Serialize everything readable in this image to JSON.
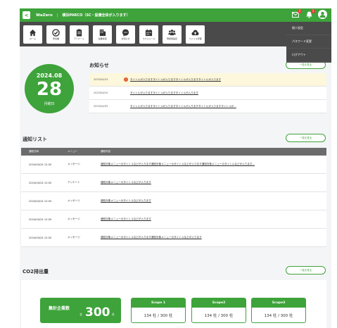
{
  "header": {
    "app_name": "WaZero",
    "separator": "|",
    "company": "横浜PARCO（SC・設備全体が入ります）",
    "mail_badge": "1",
    "bell_badge": "1"
  },
  "user_menu": {
    "items": [
      {
        "label": "個人設定"
      },
      {
        "label": "パスワード変更"
      },
      {
        "label": "ログアウト"
      }
    ]
  },
  "nav": {
    "items": [
      {
        "label": "ホーム",
        "icon": "home-icon"
      },
      {
        "label": "申出書",
        "icon": "form-icon"
      },
      {
        "label": "アンケート",
        "icon": "survey-icon"
      },
      {
        "label": "企業情報",
        "icon": "building-icon"
      },
      {
        "label": "お知らせ",
        "icon": "chat-icon"
      },
      {
        "label": "スケジュール",
        "icon": "calendar-icon"
      },
      {
        "label": "現場者設定",
        "icon": "people-icon"
      },
      {
        "label": "ファイル管理",
        "icon": "cloud-upload-icon"
      }
    ]
  },
  "date": {
    "year_month": "2024.08",
    "day": "28",
    "weekday": "月曜日"
  },
  "notices": {
    "title": "お知らせ",
    "more_label": "一覧を見る",
    "items": [
      {
        "date": "2023/04/24",
        "text": "タイトルが入りますタイトルが入りますタイトルが入りますタイトルが入ります",
        "important": true
      },
      {
        "date": "2023/04/10",
        "text": "タイトルが入りますタイトルが入りますタイトルが入ります",
        "important": false
      },
      {
        "date": "2023/04/03",
        "text": "タイトルが入りますタイトルが入りますタイトルが入りますタイトルが入りますタイトルが...",
        "important": false
      }
    ]
  },
  "notification_list": {
    "title": "通知リスト",
    "more_label": "一覧を見る",
    "columns": [
      "通知日時",
      "メニュー",
      "通知内容"
    ],
    "rows": [
      {
        "datetime": "2024/04/24 12:00",
        "menu": "メッセージ",
        "content": "通知対象メニューのタイトルなどが入ります通知対象メニューのタイトルなどが入ります通知対象メニューのタイトルなどが入ります..."
      },
      {
        "datetime": "2024/04/24 12:00",
        "menu": "アンケート",
        "content": "通知対象メニューのタイトルなどが入ります"
      },
      {
        "datetime": "2024/04/24 12:00",
        "menu": "メッセージ",
        "content": "通知対象メニューのタイトルなどが入ります"
      },
      {
        "datetime": "2024/04/24 12:00",
        "menu": "メッセージ",
        "content": "通知対象メニューのタイトルなどが入ります"
      },
      {
        "datetime": "2024/04/24 12:00",
        "menu": "メッセージ",
        "content": "通知対象メニューのタイトルなどが入ります通知対象メニューのタイトルなどが入ります"
      }
    ]
  },
  "co2": {
    "title": "CO2排出量",
    "more_label": "一覧を見る",
    "company_count": {
      "label": "集計企業数",
      "prefix": "全",
      "value": "300",
      "unit": "社"
    },
    "scopes": [
      {
        "label": "Scope 1",
        "value": "134 社 / 300 社"
      },
      {
        "label": "Scope2",
        "value": "134 社 / 300 社"
      },
      {
        "label": "Scope3",
        "value": "134 社 / 300 社"
      }
    ]
  },
  "colors": {
    "brand_green": "#3da33a",
    "nav_dark": "#4a4a4a",
    "alert_orange": "#e2572b",
    "highlight_yellow": "#fdf7dc"
  }
}
